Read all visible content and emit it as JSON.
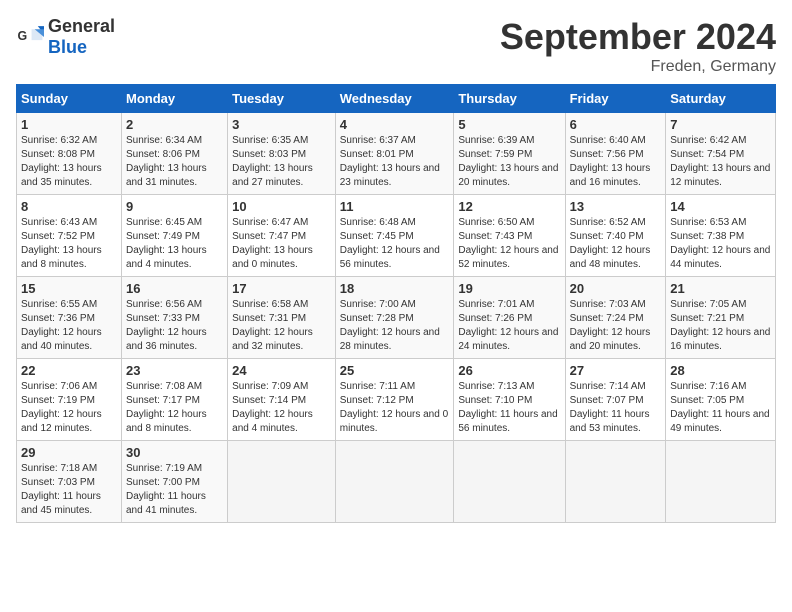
{
  "logo": {
    "general": "General",
    "blue": "Blue"
  },
  "title": "September 2024",
  "location": "Freden, Germany",
  "days_header": [
    "Sunday",
    "Monday",
    "Tuesday",
    "Wednesday",
    "Thursday",
    "Friday",
    "Saturday"
  ],
  "weeks": [
    [
      {
        "day": "1",
        "sunrise": "Sunrise: 6:32 AM",
        "sunset": "Sunset: 8:08 PM",
        "daylight": "Daylight: 13 hours and 35 minutes."
      },
      {
        "day": "2",
        "sunrise": "Sunrise: 6:34 AM",
        "sunset": "Sunset: 8:06 PM",
        "daylight": "Daylight: 13 hours and 31 minutes."
      },
      {
        "day": "3",
        "sunrise": "Sunrise: 6:35 AM",
        "sunset": "Sunset: 8:03 PM",
        "daylight": "Daylight: 13 hours and 27 minutes."
      },
      {
        "day": "4",
        "sunrise": "Sunrise: 6:37 AM",
        "sunset": "Sunset: 8:01 PM",
        "daylight": "Daylight: 13 hours and 23 minutes."
      },
      {
        "day": "5",
        "sunrise": "Sunrise: 6:39 AM",
        "sunset": "Sunset: 7:59 PM",
        "daylight": "Daylight: 13 hours and 20 minutes."
      },
      {
        "day": "6",
        "sunrise": "Sunrise: 6:40 AM",
        "sunset": "Sunset: 7:56 PM",
        "daylight": "Daylight: 13 hours and 16 minutes."
      },
      {
        "day": "7",
        "sunrise": "Sunrise: 6:42 AM",
        "sunset": "Sunset: 7:54 PM",
        "daylight": "Daylight: 13 hours and 12 minutes."
      }
    ],
    [
      {
        "day": "8",
        "sunrise": "Sunrise: 6:43 AM",
        "sunset": "Sunset: 7:52 PM",
        "daylight": "Daylight: 13 hours and 8 minutes."
      },
      {
        "day": "9",
        "sunrise": "Sunrise: 6:45 AM",
        "sunset": "Sunset: 7:49 PM",
        "daylight": "Daylight: 13 hours and 4 minutes."
      },
      {
        "day": "10",
        "sunrise": "Sunrise: 6:47 AM",
        "sunset": "Sunset: 7:47 PM",
        "daylight": "Daylight: 13 hours and 0 minutes."
      },
      {
        "day": "11",
        "sunrise": "Sunrise: 6:48 AM",
        "sunset": "Sunset: 7:45 PM",
        "daylight": "Daylight: 12 hours and 56 minutes."
      },
      {
        "day": "12",
        "sunrise": "Sunrise: 6:50 AM",
        "sunset": "Sunset: 7:43 PM",
        "daylight": "Daylight: 12 hours and 52 minutes."
      },
      {
        "day": "13",
        "sunrise": "Sunrise: 6:52 AM",
        "sunset": "Sunset: 7:40 PM",
        "daylight": "Daylight: 12 hours and 48 minutes."
      },
      {
        "day": "14",
        "sunrise": "Sunrise: 6:53 AM",
        "sunset": "Sunset: 7:38 PM",
        "daylight": "Daylight: 12 hours and 44 minutes."
      }
    ],
    [
      {
        "day": "15",
        "sunrise": "Sunrise: 6:55 AM",
        "sunset": "Sunset: 7:36 PM",
        "daylight": "Daylight: 12 hours and 40 minutes."
      },
      {
        "day": "16",
        "sunrise": "Sunrise: 6:56 AM",
        "sunset": "Sunset: 7:33 PM",
        "daylight": "Daylight: 12 hours and 36 minutes."
      },
      {
        "day": "17",
        "sunrise": "Sunrise: 6:58 AM",
        "sunset": "Sunset: 7:31 PM",
        "daylight": "Daylight: 12 hours and 32 minutes."
      },
      {
        "day": "18",
        "sunrise": "Sunrise: 7:00 AM",
        "sunset": "Sunset: 7:28 PM",
        "daylight": "Daylight: 12 hours and 28 minutes."
      },
      {
        "day": "19",
        "sunrise": "Sunrise: 7:01 AM",
        "sunset": "Sunset: 7:26 PM",
        "daylight": "Daylight: 12 hours and 24 minutes."
      },
      {
        "day": "20",
        "sunrise": "Sunrise: 7:03 AM",
        "sunset": "Sunset: 7:24 PM",
        "daylight": "Daylight: 12 hours and 20 minutes."
      },
      {
        "day": "21",
        "sunrise": "Sunrise: 7:05 AM",
        "sunset": "Sunset: 7:21 PM",
        "daylight": "Daylight: 12 hours and 16 minutes."
      }
    ],
    [
      {
        "day": "22",
        "sunrise": "Sunrise: 7:06 AM",
        "sunset": "Sunset: 7:19 PM",
        "daylight": "Daylight: 12 hours and 12 minutes."
      },
      {
        "day": "23",
        "sunrise": "Sunrise: 7:08 AM",
        "sunset": "Sunset: 7:17 PM",
        "daylight": "Daylight: 12 hours and 8 minutes."
      },
      {
        "day": "24",
        "sunrise": "Sunrise: 7:09 AM",
        "sunset": "Sunset: 7:14 PM",
        "daylight": "Daylight: 12 hours and 4 minutes."
      },
      {
        "day": "25",
        "sunrise": "Sunrise: 7:11 AM",
        "sunset": "Sunset: 7:12 PM",
        "daylight": "Daylight: 12 hours and 0 minutes."
      },
      {
        "day": "26",
        "sunrise": "Sunrise: 7:13 AM",
        "sunset": "Sunset: 7:10 PM",
        "daylight": "Daylight: 11 hours and 56 minutes."
      },
      {
        "day": "27",
        "sunrise": "Sunrise: 7:14 AM",
        "sunset": "Sunset: 7:07 PM",
        "daylight": "Daylight: 11 hours and 53 minutes."
      },
      {
        "day": "28",
        "sunrise": "Sunrise: 7:16 AM",
        "sunset": "Sunset: 7:05 PM",
        "daylight": "Daylight: 11 hours and 49 minutes."
      }
    ],
    [
      {
        "day": "29",
        "sunrise": "Sunrise: 7:18 AM",
        "sunset": "Sunset: 7:03 PM",
        "daylight": "Daylight: 11 hours and 45 minutes."
      },
      {
        "day": "30",
        "sunrise": "Sunrise: 7:19 AM",
        "sunset": "Sunset: 7:00 PM",
        "daylight": "Daylight: 11 hours and 41 minutes."
      },
      null,
      null,
      null,
      null,
      null
    ]
  ]
}
